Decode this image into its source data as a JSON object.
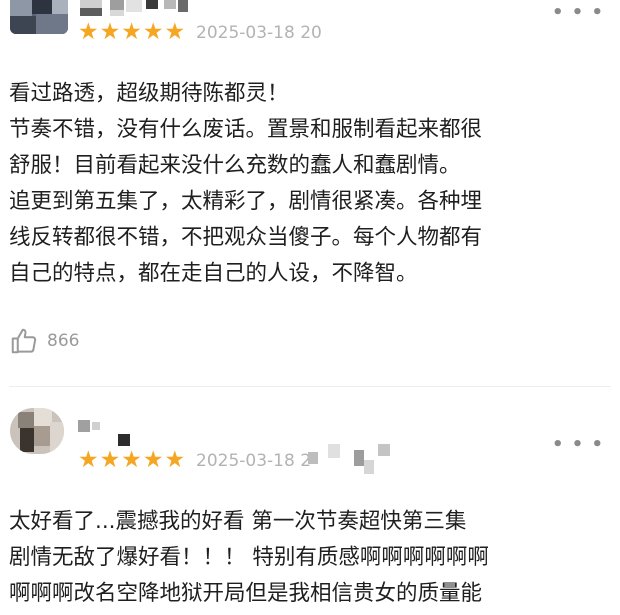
{
  "reviews": [
    {
      "username": "",
      "rating": 5,
      "stars": "★★★★★",
      "date": "2025-03-18 20",
      "more_icon": "more-dots-icon",
      "more_glyph": "• • •",
      "content_lines": [
        "看过路透，超级期待陈都灵！",
        "节奏不错，没有什么废话。置景和服制看起来都很",
        "舒服！目前看起来没什么充数的蠢人和蠢剧情。",
        "追更到第五集了，太精彩了，剧情很紧凑。各种埋",
        "线反转都很不错，不把观众当傻子。每个人物都有",
        "自己的特点，都在走自己的人设，不降智。"
      ],
      "like_icon": "thumbs-up-icon",
      "likes": "866"
    },
    {
      "username": "",
      "rating": 5,
      "stars": "★★★★★",
      "date": "2025-03-18 2",
      "more_icon": "more-dots-icon",
      "more_glyph": "• • •",
      "content_lines": [
        "太好看了...震撼我的好看 第一次节奏超快第三集",
        "剧情无敌了爆好看！！！ 特别有质感啊啊啊啊啊啊",
        "啊啊啊改名空降地狱开局但是我相信贵女的质量能"
      ]
    }
  ],
  "colors": {
    "star": "#f5a623",
    "date": "#b3b3b3",
    "text": "#1f1f1f",
    "like": "#9a9a9a",
    "divider": "#ededed"
  }
}
